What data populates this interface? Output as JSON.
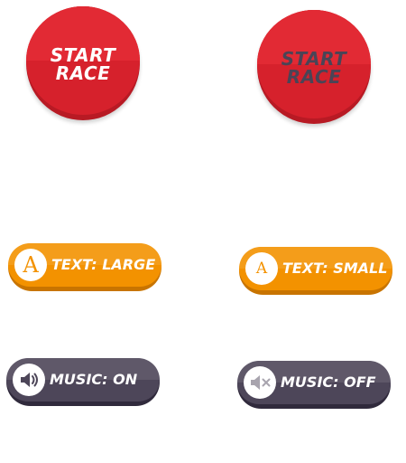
{
  "start_race_buttons": [
    {
      "line1": "START",
      "line2": "RACE",
      "state": "active",
      "text_color": "#ffffff"
    },
    {
      "line1": "START",
      "line2": "RACE",
      "state": "inactive",
      "text_color": "#4a4456"
    }
  ],
  "text_size_buttons": [
    {
      "label": "TEXT: LARGE",
      "icon_glyph": "A",
      "icon": "text-size-icon"
    },
    {
      "label": "TEXT: SMALL",
      "icon_glyph": "A",
      "icon": "text-size-icon"
    }
  ],
  "music_buttons": [
    {
      "label": "MUSIC: ON",
      "icon": "speaker-on-icon"
    },
    {
      "label": "MUSIC: OFF",
      "icon": "speaker-muted-icon"
    }
  ],
  "colors": {
    "race_red": "#d6212c",
    "text_orange": "#f39200",
    "music_dark": "#4d4659",
    "white": "#ffffff"
  }
}
